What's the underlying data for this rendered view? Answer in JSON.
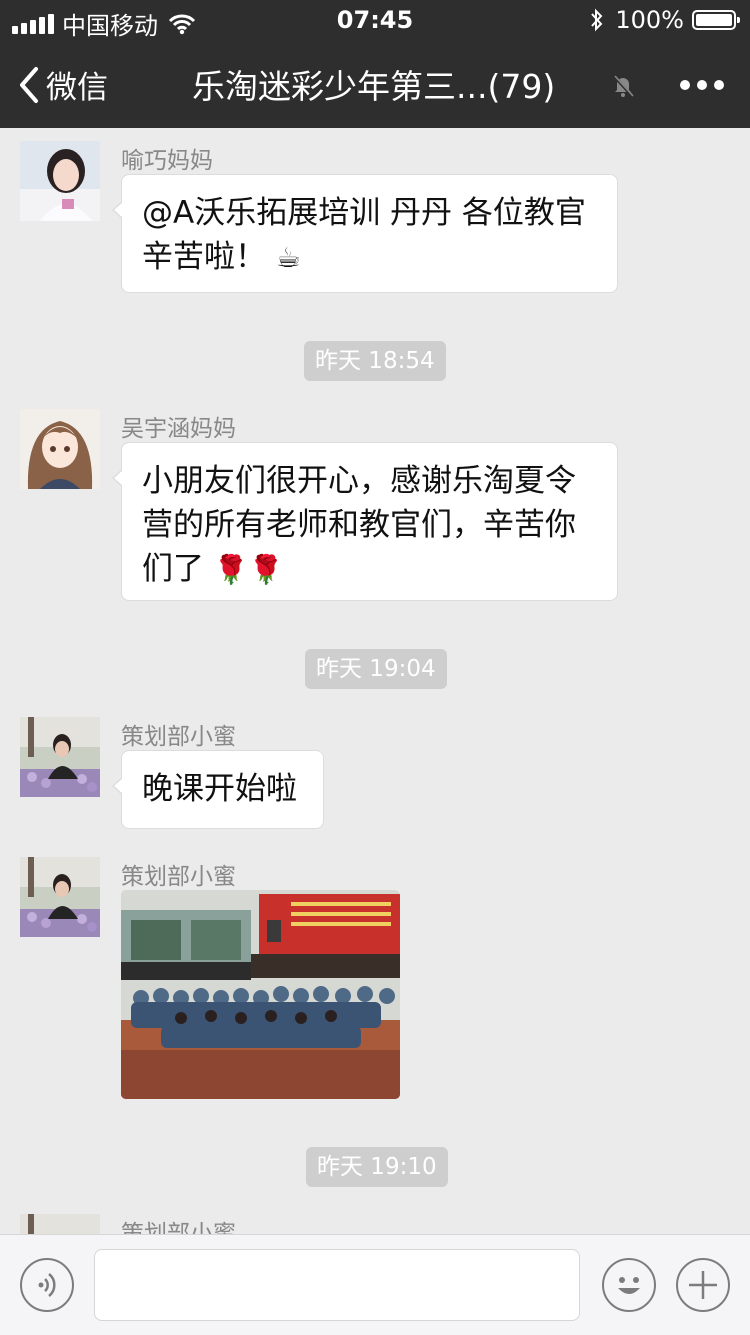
{
  "status_bar": {
    "carrier": "中国移动",
    "time": "07:45",
    "battery": "100%",
    "battery_level": 1.0
  },
  "nav": {
    "back_label": "微信",
    "title": "乐淘迷彩少年第三...(79)"
  },
  "messages": [
    {
      "sender": "喻巧妈妈",
      "text": "@A沃乐拓展培训 丹丹 各位教官辛苦啦！",
      "emoji": "☕"
    },
    {
      "sender": "吴宇涵妈妈",
      "text": "小朋友们很开心，感谢乐淘夏令营的所有老师和教官们，辛苦你们了",
      "emoji": "🌹🌹"
    },
    {
      "sender": "策划部小蜜",
      "text": "晚课开始啦"
    },
    {
      "sender": "策划部小蜜",
      "image": "photo of children seated on floor"
    },
    {
      "sender": "策划部小蜜"
    }
  ],
  "timestamps": [
    "昨天 18:54",
    "昨天 19:04",
    "昨天 19:10"
  ],
  "input": {
    "value": "",
    "placeholder": ""
  },
  "icons": [
    "signal-icon",
    "wifi-icon",
    "bluetooth-icon",
    "battery-icon",
    "back-chevron-icon",
    "mute-bell-icon",
    "more-icon",
    "voice-icon",
    "emoji-icon",
    "plus-icon"
  ],
  "colors": {
    "bar_background": "#2e2e2e",
    "chat_background": "#ebebeb",
    "timestamp_background": "#cecece"
  }
}
